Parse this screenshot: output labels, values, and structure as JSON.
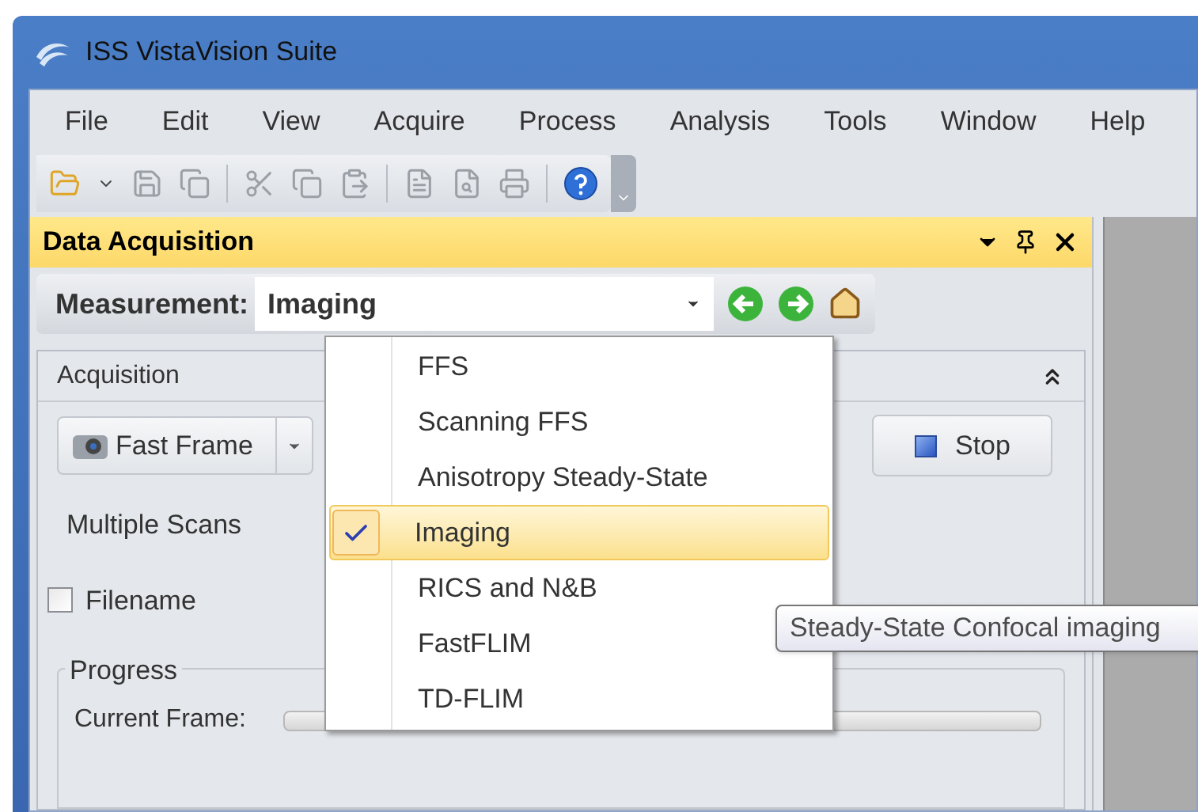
{
  "window": {
    "title": "ISS VistaVision Suite"
  },
  "menu": [
    "File",
    "Edit",
    "View",
    "Acquire",
    "Process",
    "Analysis",
    "Tools",
    "Window",
    "Help"
  ],
  "panel": {
    "title": "Data Acquisition",
    "measurement_label": "Measurement:",
    "measurement_value": "Imaging"
  },
  "acquisition": {
    "title": "Acquisition",
    "mode_button": "Fast Frame",
    "stop_button": "Stop",
    "multiple_scans": "Multiple Scans",
    "filename": {
      "label": "Filename",
      "checked": false
    },
    "progress": {
      "title": "Progress",
      "current_frame_label": "Current Frame:",
      "level": 0
    }
  },
  "dropdown": {
    "items": [
      {
        "label": "FFS",
        "selected": false
      },
      {
        "label": "Scanning FFS",
        "selected": false
      },
      {
        "label": "Anisotropy Steady-State",
        "selected": false
      },
      {
        "label": "Imaging",
        "selected": true
      },
      {
        "label": "RICS and N&B",
        "selected": false
      },
      {
        "label": "FastFLIM",
        "selected": false
      },
      {
        "label": "TD-FLIM",
        "selected": false
      }
    ]
  },
  "tooltip": "Steady-State Confocal imaging"
}
